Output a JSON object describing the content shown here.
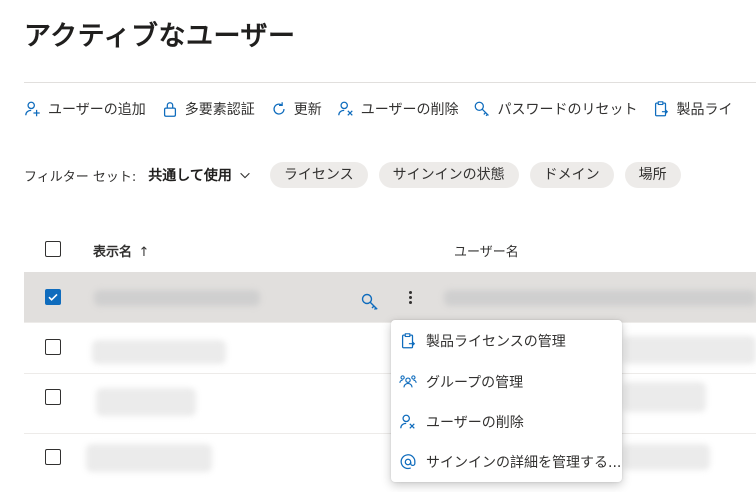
{
  "page": {
    "title": "アクティブなユーザー"
  },
  "toolbar": {
    "items": [
      {
        "label": "ユーザーの追加"
      },
      {
        "label": "多要素認証"
      },
      {
        "label": "更新"
      },
      {
        "label": "ユーザーの削除"
      },
      {
        "label": "パスワードのリセット"
      },
      {
        "label": "製品ライ"
      }
    ]
  },
  "filters": {
    "label": "フィルター セット:",
    "selected": "共通して使用",
    "chips": [
      "ライセンス",
      "サインインの状態",
      "ドメイン",
      "場所"
    ]
  },
  "table": {
    "columns": {
      "display_name": "表示名",
      "sort_indicator": "↑",
      "username": "ユーザー名"
    }
  },
  "context_menu": {
    "items": [
      {
        "label": "製品ライセンスの管理",
        "icon": "license-icon"
      },
      {
        "label": "グループの管理",
        "icon": "group-icon"
      },
      {
        "label": "ユーザーの削除",
        "icon": "delete-user-icon"
      },
      {
        "label": "サインインの詳細を管理する...",
        "icon": "at-icon"
      }
    ]
  },
  "colors": {
    "accent": "#0f6cbd",
    "selected_row": "#e1dfdd",
    "chip": "#edebe9"
  }
}
